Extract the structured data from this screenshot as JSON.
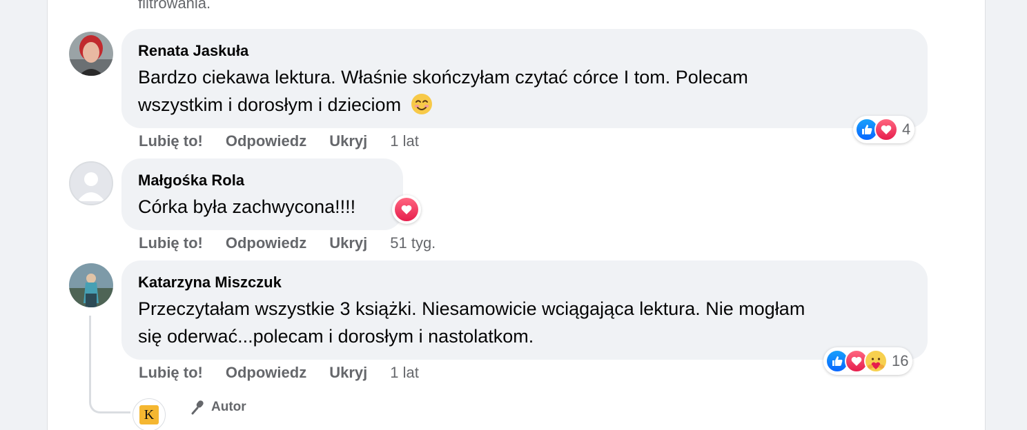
{
  "top_fragment": "filtrowania.",
  "comments": [
    {
      "author": "Renata Jaskuła",
      "text_line1": "Bardzo ciekawa lektura. Właśnie skończyłam czytać córce I tom. Polecam",
      "text_line2": "wszystkim i dorosłym i dzieciom",
      "like": "Lubię to!",
      "reply": "Odpowiedz",
      "hide": "Ukryj",
      "time": "1 lat",
      "reaction_count": "4"
    },
    {
      "author": "Małgośka Rola",
      "text_line1": "Córka była zachwycona!!!!",
      "like": "Lubię to!",
      "reply": "Odpowiedz",
      "hide": "Ukryj",
      "time": "51 tyg."
    },
    {
      "author": "Katarzyna Miszczuk",
      "text_line1": "Przeczytałam wszystkie 3 książki. Niesamowicie wciągająca lektura. Nie mogłam",
      "text_line2": "się oderwać...polecam i dorosłym i nastolatkom.",
      "like": "Lubię to!",
      "reply": "Odpowiedz",
      "hide": "Ukryj",
      "time": "1 lat",
      "reaction_count": "16"
    }
  ],
  "reply": {
    "badge": "Autor",
    "logo_letter": "K"
  },
  "colors": {
    "like": "#0866ff",
    "love": "#e61e4d",
    "care": "#f7d04f",
    "bubble": "#f0f2f5",
    "meta": "#65676b"
  },
  "icons": [
    "like-icon",
    "love-icon",
    "care-icon",
    "smiling-face-emoji",
    "microphone-icon"
  ]
}
